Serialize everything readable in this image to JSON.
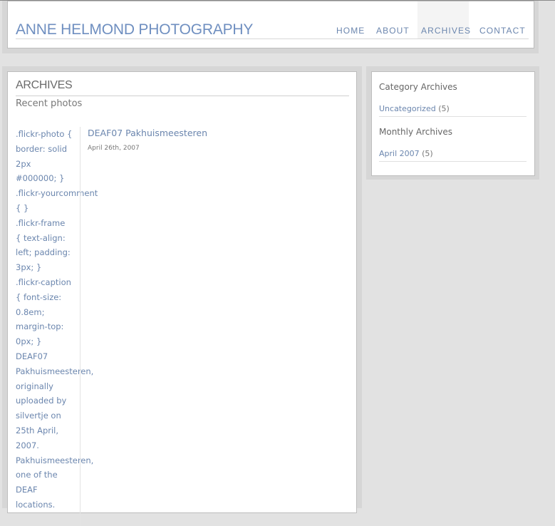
{
  "site": {
    "title": "ANNE HELMOND PHOTOGRAPHY"
  },
  "nav": {
    "items": [
      {
        "label": "HOME"
      },
      {
        "label": "ABOUT"
      },
      {
        "label": "ARCHIVES"
      },
      {
        "label": "CONTACT"
      }
    ],
    "active": "ARCHIVES"
  },
  "main": {
    "title": "ARCHIVES",
    "subtitle": "Recent photos",
    "flickr_text_lines": [
      ".flickr-photo {",
      "border: solid",
      "2px",
      "#000000; }",
      ".flickr-yourcomment",
      "{ }",
      ".flickr-frame",
      "{ text-align:",
      "left; padding:",
      "3px; }",
      ".flickr-caption",
      "{ font-size:",
      "0.8em;",
      "margin-top:",
      "0px; }",
      "DEAF07",
      "Pakhuismeesteren,",
      "originally",
      "uploaded by",
      "silvertje on",
      "25th April,",
      "2007.",
      "Pakhuismeesteren,",
      "one of the",
      "DEAF",
      "locations."
    ],
    "post": {
      "title": "DEAF07 Pakhuismeesteren",
      "date": "April 26th, 2007"
    }
  },
  "sidebar": {
    "category_heading": "Category Archives",
    "category_link": {
      "label": "Uncategorized",
      "count": "(5)"
    },
    "monthly_heading": "Monthly Archives",
    "monthly_link": {
      "label": "April 2007",
      "count": "(5)"
    }
  },
  "colors": {
    "link": "#6b86ae",
    "title": "#6f8fc0",
    "background": "#e2e2e2"
  }
}
